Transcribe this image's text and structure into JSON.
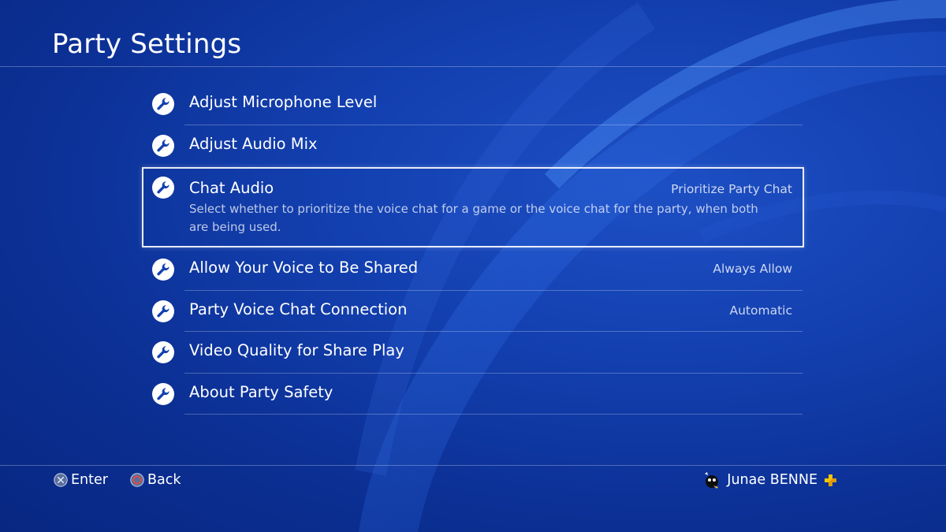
{
  "header": {
    "title": "Party Settings"
  },
  "menu": {
    "items": [
      {
        "label": "Adjust Microphone Level",
        "value": "",
        "icon": "wrench-icon"
      },
      {
        "label": "Adjust Audio Mix",
        "value": "",
        "icon": "wrench-icon"
      },
      {
        "label": "Chat Audio",
        "value": "Prioritize Party Chat",
        "icon": "wrench-icon",
        "description": "Select whether to prioritize the voice chat for a game or the voice chat for the party, when both are being used.",
        "selected": true
      },
      {
        "label": "Allow Your Voice to Be Shared",
        "value": "Always Allow",
        "icon": "wrench-icon"
      },
      {
        "label": "Party Voice Chat Connection",
        "value": "Automatic",
        "icon": "wrench-icon"
      },
      {
        "label": "Video Quality for Share Play",
        "value": "",
        "icon": "wrench-icon"
      },
      {
        "label": "About Party Safety",
        "value": "",
        "icon": "wrench-icon"
      }
    ]
  },
  "footer": {
    "enter_label": "Enter",
    "enter_icon": "cross-button-icon",
    "back_label": "Back",
    "back_icon": "circle-button-icon",
    "user_name": "Junae BENNE",
    "user_badge_icon": "playstation-plus-icon"
  },
  "colors": {
    "background": "#1340b0",
    "text": "#ffffff",
    "value_text": "#d0d9f0",
    "circle_button": "#e8483a",
    "plus_badge": "#f5c400"
  }
}
